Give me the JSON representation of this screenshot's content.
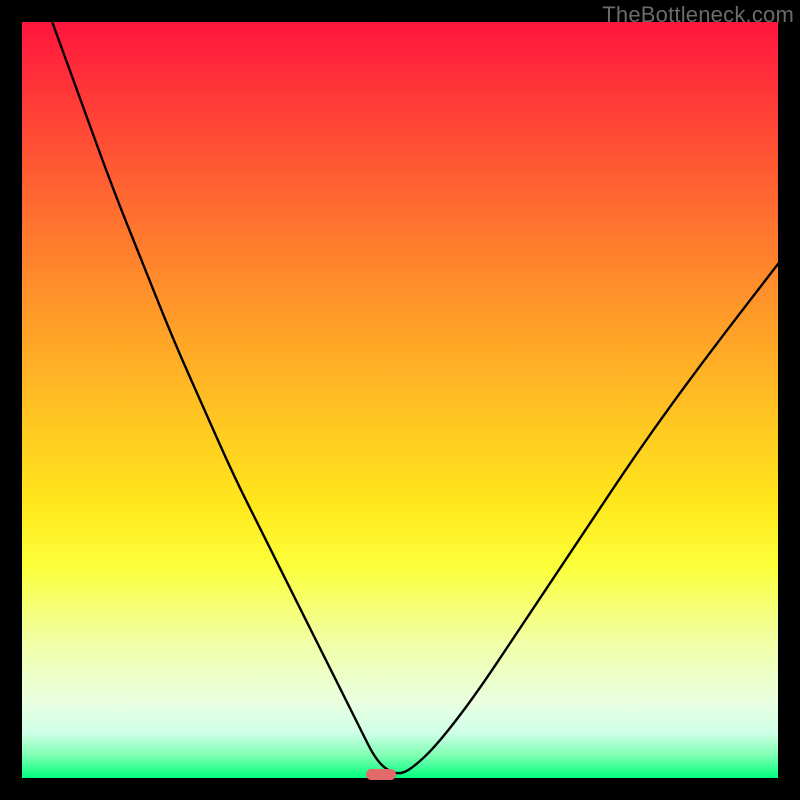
{
  "watermark": "TheBottleneck.com",
  "chart_data": {
    "type": "line",
    "title": "",
    "xlabel": "",
    "ylabel": "",
    "xlim": [
      0,
      100
    ],
    "ylim": [
      0,
      100
    ],
    "grid": false,
    "series": [
      {
        "name": "curve",
        "color": "#000000",
        "x": [
          4,
          8,
          12,
          16,
          20,
          24,
          28,
          32,
          36,
          40,
          43,
          45,
          46.5,
          48,
          50,
          52,
          55,
          60,
          66,
          74,
          82,
          90,
          100
        ],
        "y": [
          100,
          89,
          78,
          68,
          58,
          49,
          40,
          32,
          24,
          16,
          10,
          6,
          3,
          1.2,
          0.4,
          1.6,
          4.5,
          11,
          20,
          32,
          44,
          55,
          68
        ]
      }
    ],
    "marker": {
      "x": 47.5,
      "y": 0.5,
      "width": 4,
      "height": 1.5,
      "color": "#e26a6a"
    }
  }
}
